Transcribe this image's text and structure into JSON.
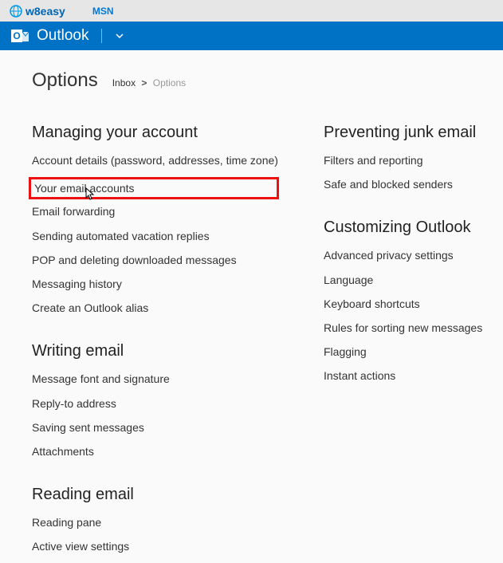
{
  "topbar": {
    "brand": "w8easy",
    "msn": "MSN"
  },
  "outlook": {
    "label": "Outlook"
  },
  "page": {
    "title": "Options",
    "breadcrumb_inbox": "Inbox",
    "breadcrumb_sep": ">",
    "breadcrumb_current": "Options"
  },
  "col1": {
    "sec1": {
      "heading": "Managing your account",
      "items": [
        "Account details (password, addresses, time zone)",
        "Your email accounts",
        "Email forwarding",
        "Sending automated vacation replies",
        "POP and deleting downloaded messages",
        "Messaging history",
        "Create an Outlook alias"
      ]
    },
    "sec2": {
      "heading": "Writing email",
      "items": [
        "Message font and signature",
        "Reply-to address",
        "Saving sent messages",
        "Attachments"
      ]
    },
    "sec3": {
      "heading": "Reading email",
      "items": [
        "Reading pane",
        "Active view settings"
      ]
    }
  },
  "col2": {
    "sec1": {
      "heading": "Preventing junk email",
      "items": [
        "Filters and reporting",
        "Safe and blocked senders"
      ]
    },
    "sec2": {
      "heading": "Customizing Outlook",
      "items": [
        "Advanced privacy settings",
        "Language",
        "Keyboard shortcuts",
        "Rules for sorting new messages",
        "Flagging",
        "Instant actions"
      ]
    }
  }
}
